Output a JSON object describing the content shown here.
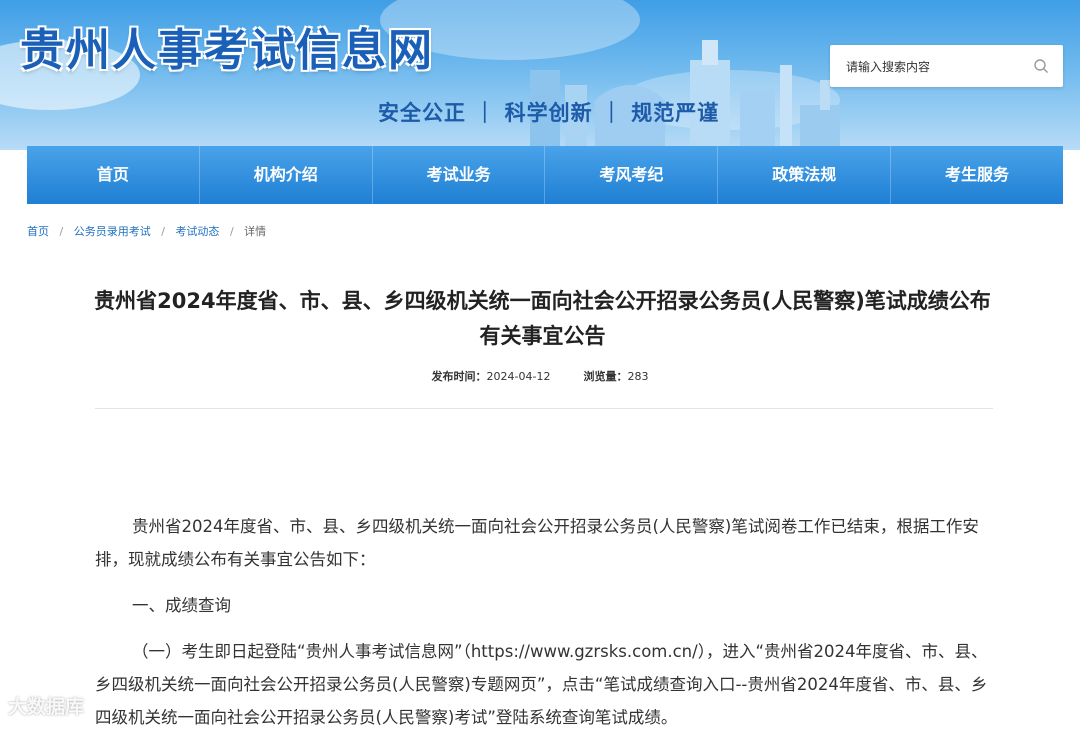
{
  "header": {
    "site_title": "贵州人事考试信息网",
    "motto": "安全公正 ｜ 科学创新 ｜ 规范严谨",
    "search_placeholder": "请输入搜索内容"
  },
  "nav": {
    "items": [
      {
        "label": "首页"
      },
      {
        "label": "机构介绍"
      },
      {
        "label": "考试业务"
      },
      {
        "label": "考风考纪"
      },
      {
        "label": "政策法规"
      },
      {
        "label": "考生服务"
      }
    ]
  },
  "breadcrumb": {
    "items": [
      "首页",
      "公务员录用考试",
      "考试动态"
    ],
    "current": "详情",
    "separator": "/"
  },
  "article": {
    "title": "贵州省2024年度省、市、县、乡四级机关统一面向社会公开招录公务员(人民警察)笔试成绩公布有关事宜公告",
    "publish_label": "发布时间：",
    "publish_date": "2024-04-12",
    "views_label": "浏览量：",
    "views": "283",
    "paragraphs": [
      "贵州省2024年度省、市、县、乡四级机关统一面向社会公开招录公务员(人民警察)笔试阅卷工作已结束，根据工作安排，现就成绩公布有关事宜公告如下：",
      "一、成绩查询",
      "（一）考生即日起登陆“贵州人事考试信息网”（https://www.gzrsks.com.cn/），进入“贵州省2024年度省、市、县、乡四级机关统一面向社会公开招录公务员(人民警察)专题网页”，点击“笔试成绩查询入口--贵州省2024年度省、市、县、乡四级机关统一面向社会公开招录公务员(人民警察)考试”登陆系统查询笔试成绩。"
    ]
  },
  "watermark": "大数据库",
  "colors": {
    "nav_blue": "#1f7fd3",
    "title_blue": "#1a5fb8",
    "link_blue": "#1f6fbf"
  }
}
